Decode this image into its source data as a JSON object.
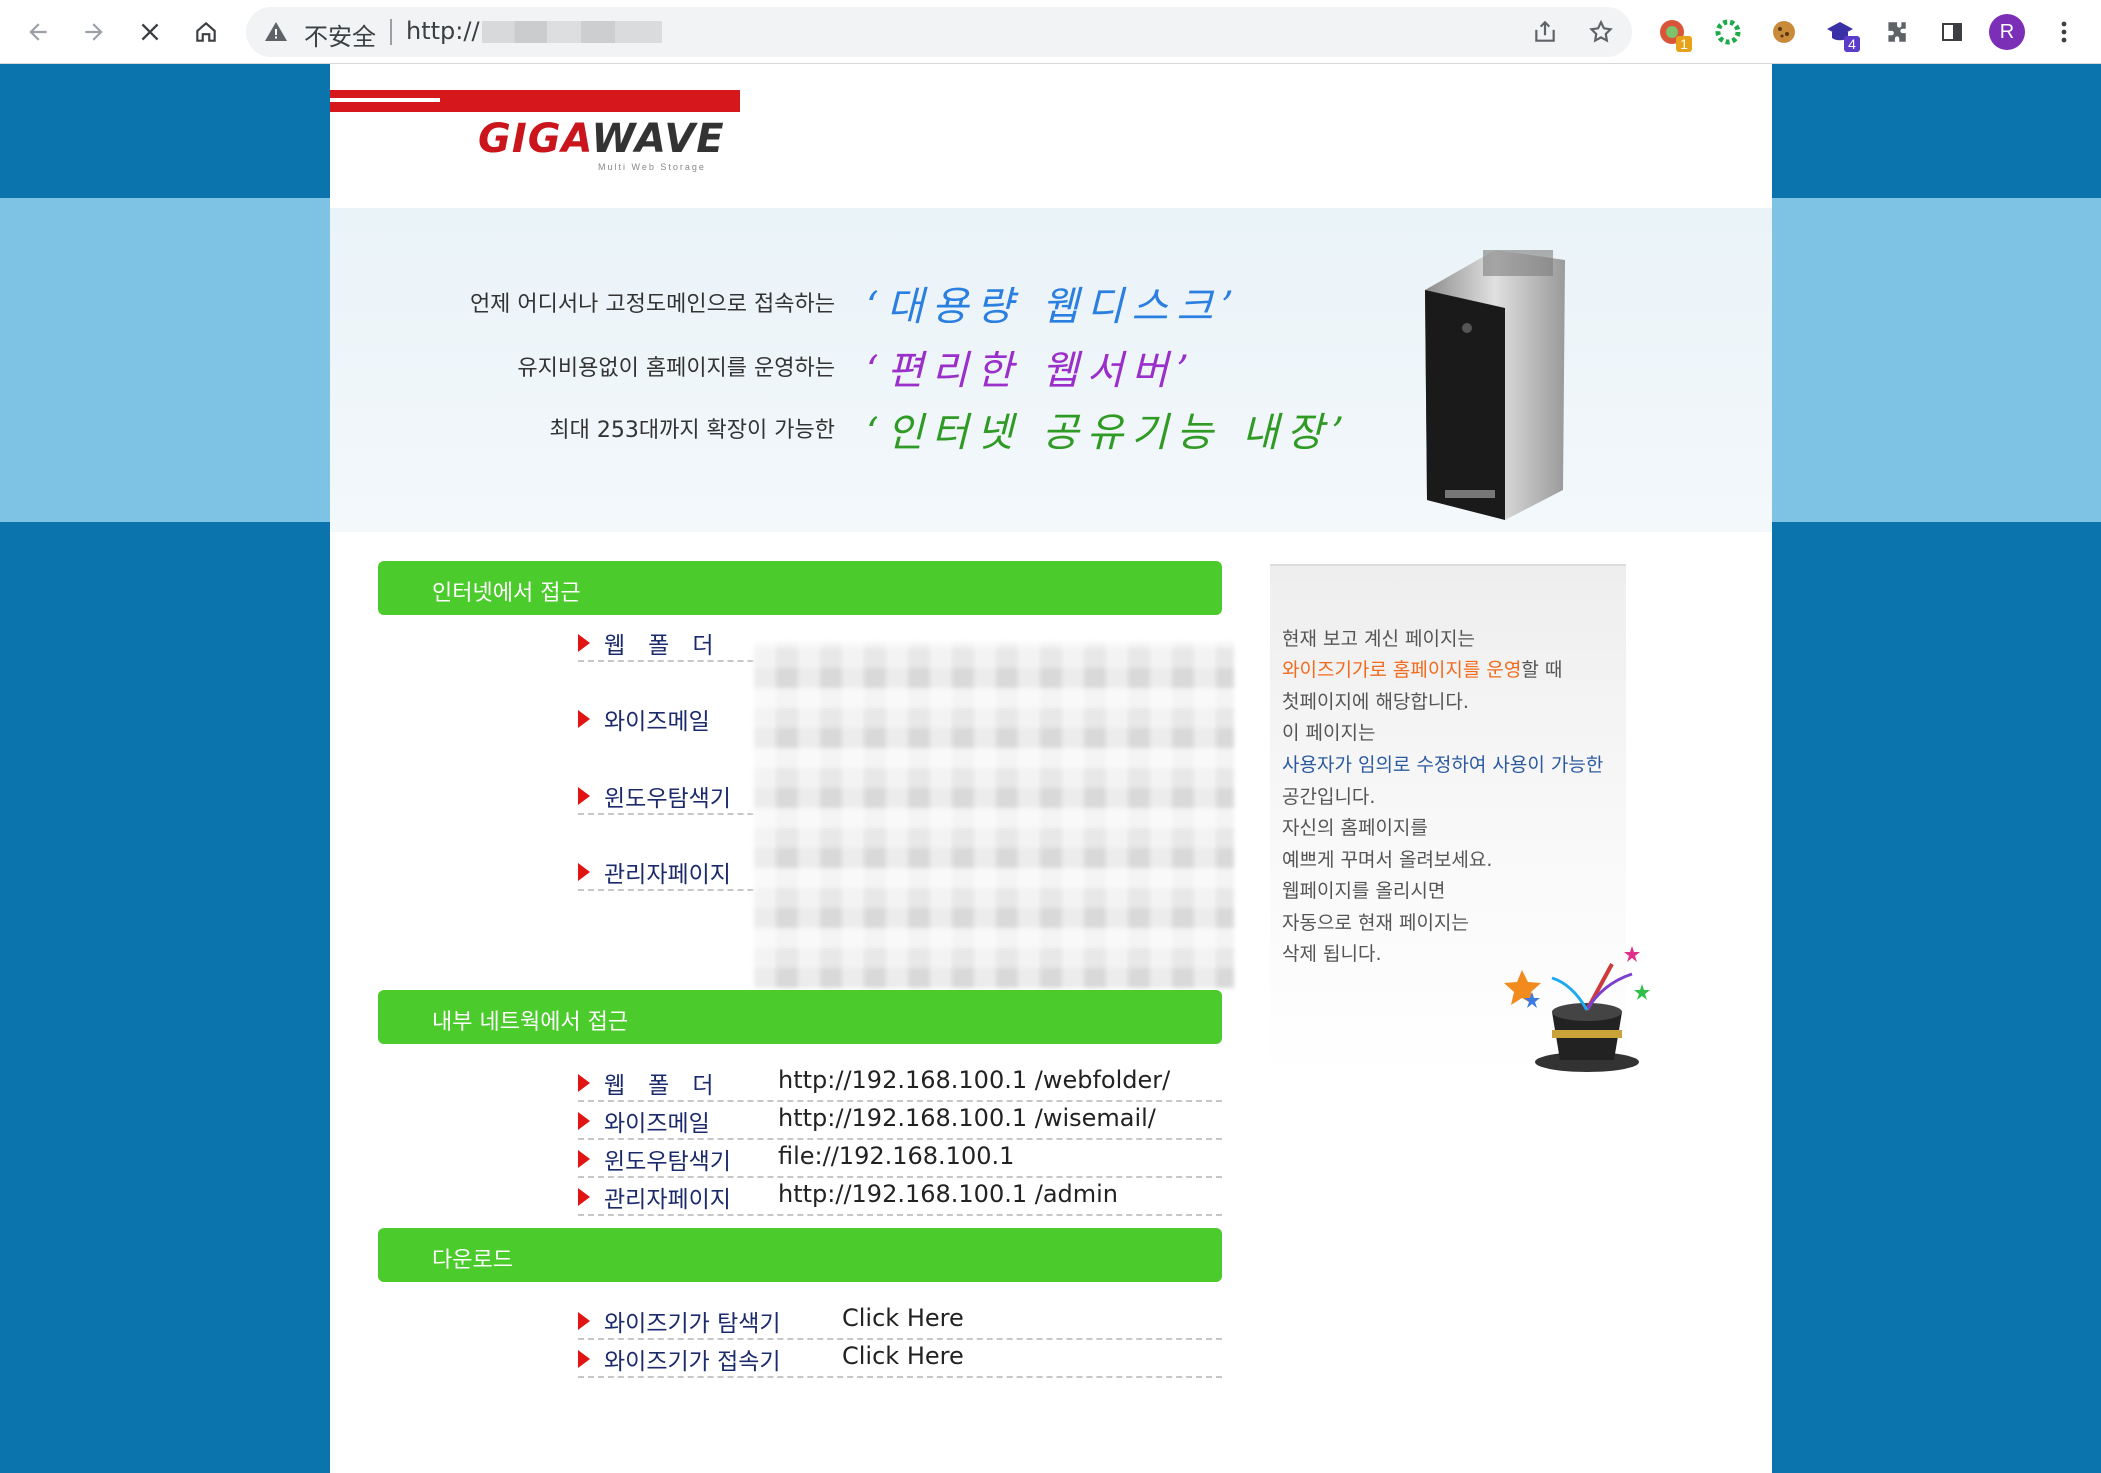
{
  "browser": {
    "security_label": "不安全",
    "url_prefix": "http://",
    "extension_badge_1": "1",
    "extension_badge_2": "4",
    "profile_initial": "R"
  },
  "brand": {
    "logo_part1": "GIGA",
    "logo_part2": "WAVE",
    "logo_subtitle": "Multi Web Storage"
  },
  "banner": {
    "rows": [
      {
        "label": "언제 어디서나 고정도메인으로 접속하는",
        "headline": "‘대용량 웹디스크’",
        "color": "#2a7fe0"
      },
      {
        "label": "유지비용없이 홈페이지를 운영하는",
        "headline": "‘편리한 웹서버’",
        "color": "#9a2fc9"
      },
      {
        "label": "최대 253대까지 확장이 가능한",
        "headline": "‘인터넷 공유기능 내장’",
        "color": "#2f9a24"
      }
    ]
  },
  "sections": {
    "internet": {
      "title": "인터넷에서 접근",
      "items": [
        {
          "label": "웹　폴　더",
          "value": ""
        },
        {
          "label": "와이즈메일",
          "value": ""
        },
        {
          "label": "윈도우탐색기",
          "value": ""
        },
        {
          "label": "관리자페이지",
          "value": ""
        }
      ]
    },
    "internal": {
      "title": "내부 네트웍에서 접근",
      "items": [
        {
          "label": "웹　폴　더",
          "value": "http://192.168.100.1 /webfolder/"
        },
        {
          "label": "와이즈메일",
          "value": "http://192.168.100.1 /wisemail/"
        },
        {
          "label": "윈도우탐색기",
          "value": "file://192.168.100.1"
        },
        {
          "label": "관리자페이지",
          "value": "http://192.168.100.1 /admin"
        }
      ]
    },
    "download": {
      "title": "다운로드",
      "items": [
        {
          "label": "와이즈기가 탐색기",
          "value": "Click Here"
        },
        {
          "label": "와이즈기가 접속기",
          "value": "Click Here"
        }
      ]
    }
  },
  "notice": {
    "line1": "현재 보고 계신 페이지는",
    "line2_highlight": "와이즈기가로 홈페이지를 운영",
    "line2_rest": "할 때",
    "line3": "첫페이지에 해당합니다.",
    "line4": "이 페이지는",
    "line5_highlight": "사용자가 임의로 수정하여 사용이 가능한",
    "line6": "공간입니다.",
    "line7": "자신의 홈페이지를",
    "line8": "예쁘게 꾸며서 올려보세요.",
    "line9": "웹페이지를 올리시면",
    "line10": "자동으로 현재 페이지는",
    "line11": "삭제 됩니다."
  },
  "colors": {
    "page_bg": "#0b74ad",
    "band_light": "#7ec3e3",
    "section_bar": "#4ccb2c",
    "arrow": "#e11414",
    "brand_red": "#d6171c"
  },
  "icons": [
    "back-icon",
    "forward-icon",
    "stop-icon",
    "home-icon",
    "warning-icon",
    "share-icon",
    "star-icon",
    "puzzle-icon",
    "sidepanel-icon",
    "menu-icon",
    "magic-hat-icon"
  ]
}
